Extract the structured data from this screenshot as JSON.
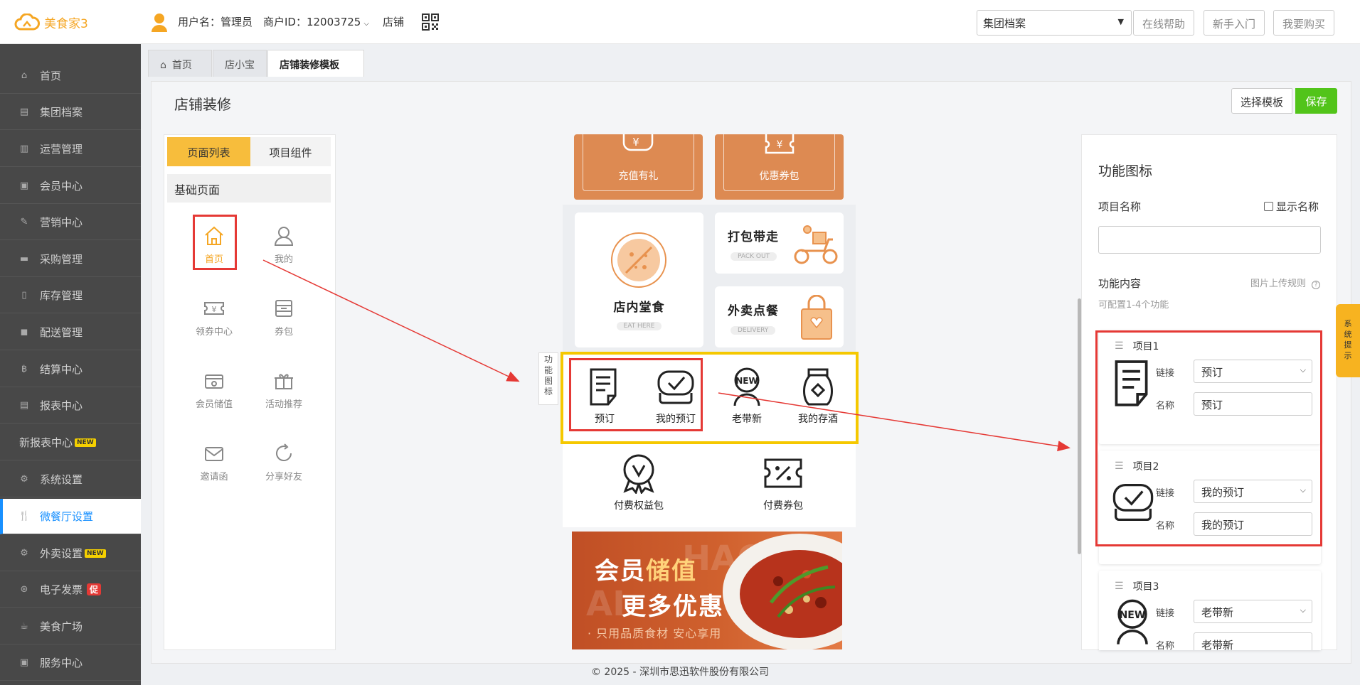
{
  "app": {
    "logo": "美食家3"
  },
  "header": {
    "username": "用户名：管理员",
    "merchant": "商户ID：12003725",
    "store": "店铺",
    "group_select": "集团档案",
    "buttons": {
      "help": "在线帮助",
      "beginner": "新手入门",
      "buy": "我要购买"
    }
  },
  "sidebar": {
    "items": [
      {
        "label": "首页",
        "icon": "home-icon"
      },
      {
        "label": "集团档案",
        "icon": "file-icon"
      },
      {
        "label": "运营管理",
        "icon": "bar-chart-icon"
      },
      {
        "label": "会员中心",
        "icon": "id-card-icon"
      },
      {
        "label": "营销中心",
        "icon": "edit-icon"
      },
      {
        "label": "采购管理",
        "icon": "book-icon"
      },
      {
        "label": "库存管理",
        "icon": "clipboard-icon"
      },
      {
        "label": "配送管理",
        "icon": "truck-icon"
      },
      {
        "label": "结算中心",
        "icon": "bitcoin-icon"
      },
      {
        "label": "报表中心",
        "icon": "report-icon"
      },
      {
        "label": "新报表中心",
        "badge": "NEW"
      },
      {
        "label": "系统设置",
        "icon": "cogs-icon"
      },
      {
        "label": "微餐厅设置",
        "icon": "cutlery-icon",
        "active": true
      },
      {
        "label": "外卖设置",
        "icon": "gear-icon",
        "badge": "NEW"
      },
      {
        "label": "电子发票",
        "icon": "invoice-icon",
        "badge": "促"
      },
      {
        "label": "美食广场",
        "icon": "coffee-icon"
      },
      {
        "label": "服务中心",
        "icon": "service-icon"
      }
    ]
  },
  "tabs": [
    {
      "label": "首页",
      "icon": "home-icon"
    },
    {
      "label": "店小宝"
    },
    {
      "label": "店铺装修模板",
      "active": true
    }
  ],
  "page": {
    "title": "店铺装修",
    "choose_template": "选择模板",
    "save": "保存"
  },
  "left_panel": {
    "tabs": [
      "页面列表",
      "项目组件"
    ],
    "section": "基础页面",
    "pages": [
      {
        "label": "首页",
        "icon": "home-icon",
        "selected": true
      },
      {
        "label": "我的",
        "icon": "user-icon"
      },
      {
        "label": "领券中心",
        "icon": "ticket-icon"
      },
      {
        "label": "券包",
        "icon": "coupon-bag-icon"
      },
      {
        "label": "会员储值",
        "icon": "wallet-icon"
      },
      {
        "label": "活动推荐",
        "icon": "gift-icon"
      },
      {
        "label": "邀请函",
        "icon": "envelope-icon"
      },
      {
        "label": "分享好友",
        "icon": "share-icon"
      }
    ]
  },
  "preview": {
    "top_cards": [
      "充值有礼",
      "优惠券包"
    ],
    "dine_in": {
      "title": "店内堂食",
      "sub": "EAT HERE"
    },
    "pack_out": {
      "title": "打包带走",
      "sub": "PACK OUT"
    },
    "delivery": {
      "title": "外卖点餐",
      "sub": "DELIVERY"
    },
    "func_side_label": [
      "功",
      "能",
      "图",
      "标"
    ],
    "func_icons": [
      "预订",
      "我的预订",
      "老带新",
      "我的存酒"
    ],
    "paid": [
      "付费权益包",
      "付费券包"
    ],
    "banner": {
      "line1_a": "会员",
      "line1_b": "储值",
      "line2": "更多优惠",
      "line3": "· 只用品质食材  安心享用",
      "bg_text": "HAO"
    }
  },
  "right_panel": {
    "title": "功能图标",
    "item_name_label": "项目名称",
    "show_name_label": "显示名称",
    "item_name_value": "",
    "content_label": "功能内容",
    "upload_rule": "图片上传规则",
    "hint": "可配置1-4个功能",
    "link_label": "链接",
    "name_label": "名称",
    "items": [
      {
        "title": "项目1",
        "link": "预订",
        "name": "预订",
        "icon": "order-doc-icon"
      },
      {
        "title": "项目2",
        "link": "我的预订",
        "name": "我的预订",
        "icon": "my-order-icon"
      },
      {
        "title": "项目3",
        "link": "老带新",
        "name": "老带新",
        "icon": "new-user-icon"
      }
    ]
  },
  "system_tip": [
    "系",
    "统",
    "提",
    "示"
  ],
  "footer": "© 2025 - 深圳市思迅软件股份有限公司",
  "colors": {
    "accent_orange": "#f7bd3c",
    "nav_bg": "#484848",
    "active_blue": "#1890ff",
    "save_green": "#52c41a",
    "highlight_red": "#e53935",
    "highlight_yellow": "#f5c800",
    "card_orange": "#dd8a52"
  }
}
